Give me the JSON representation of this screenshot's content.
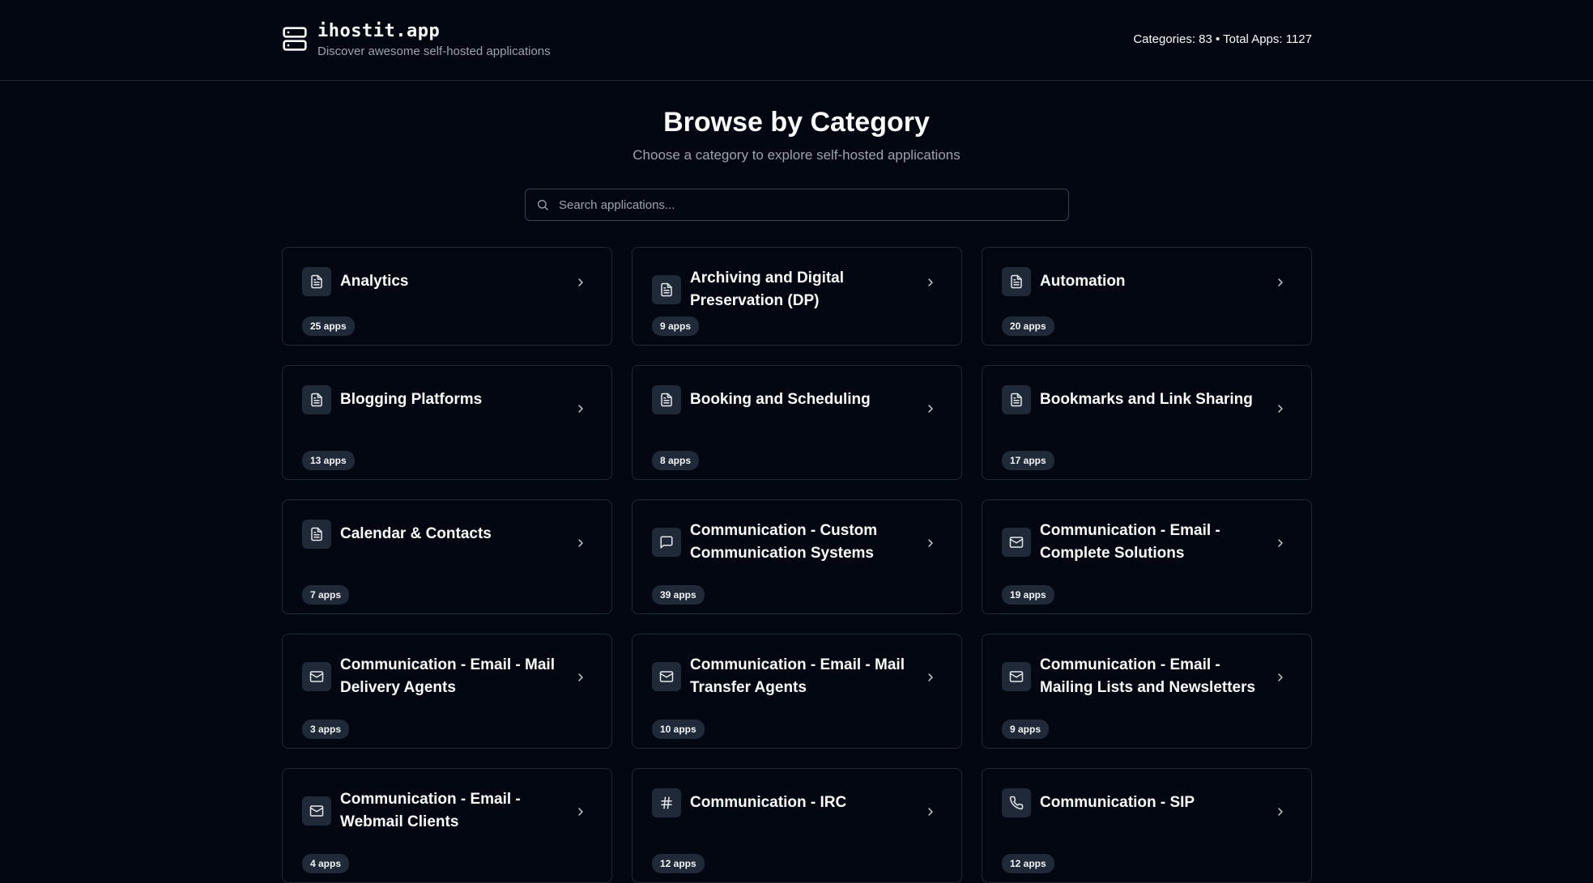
{
  "brand": {
    "title": "ihostit.app",
    "tagline": "Discover awesome self-hosted applications",
    "logo_icon": "server-icon"
  },
  "stats": "Categories: 83 • Total Apps: 1127",
  "hero": {
    "title": "Browse by Category",
    "subtitle": "Choose a category to explore self-hosted applications"
  },
  "search": {
    "placeholder": "Search applications...",
    "value": ""
  },
  "colors": {
    "background": "#030712",
    "border": "#1f2937",
    "badge_bg": "#1f2937",
    "muted_text": "#9ca3af"
  },
  "categories": [
    {
      "title": "Analytics",
      "count": "25 apps",
      "icon": "file-text-icon"
    },
    {
      "title": "Archiving and Digital Preservation (DP)",
      "count": "9 apps",
      "icon": "file-text-icon"
    },
    {
      "title": "Automation",
      "count": "20 apps",
      "icon": "file-text-icon"
    },
    {
      "title": "Blogging Platforms",
      "count": "13 apps",
      "icon": "file-text-icon"
    },
    {
      "title": "Booking and Scheduling",
      "count": "8 apps",
      "icon": "file-text-icon"
    },
    {
      "title": "Bookmarks and Link Sharing",
      "count": "17 apps",
      "icon": "file-text-icon"
    },
    {
      "title": "Calendar & Contacts",
      "count": "7 apps",
      "icon": "file-text-icon"
    },
    {
      "title": "Communication - Custom Communication Systems",
      "count": "39 apps",
      "icon": "message-square-icon"
    },
    {
      "title": "Communication - Email - Complete Solutions",
      "count": "19 apps",
      "icon": "mail-icon"
    },
    {
      "title": "Communication - Email - Mail Delivery Agents",
      "count": "3 apps",
      "icon": "mail-icon"
    },
    {
      "title": "Communication - Email - Mail Transfer Agents",
      "count": "10 apps",
      "icon": "mail-icon"
    },
    {
      "title": "Communication - Email - Mailing Lists and Newsletters",
      "count": "9 apps",
      "icon": "mail-icon"
    },
    {
      "title": "Communication - Email - Webmail Clients",
      "count": "4 apps",
      "icon": "mail-icon"
    },
    {
      "title": "Communication - IRC",
      "count": "12 apps",
      "icon": "hash-icon"
    },
    {
      "title": "Communication - SIP",
      "count": "12 apps",
      "icon": "phone-icon"
    }
  ]
}
